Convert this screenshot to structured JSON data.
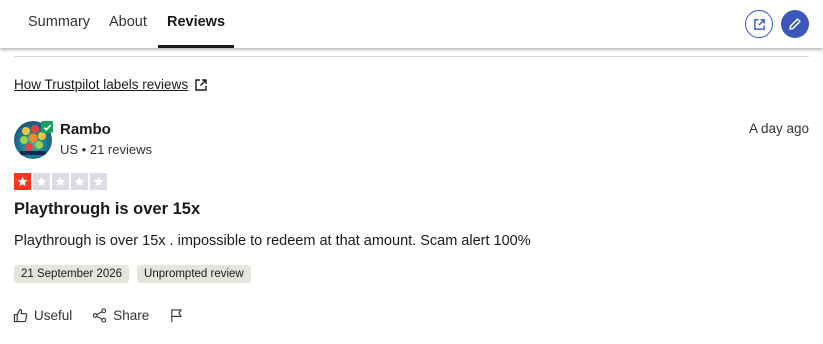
{
  "tabs": [
    {
      "label": "Summary"
    },
    {
      "label": "About"
    },
    {
      "label": "Reviews",
      "active": true
    }
  ],
  "header_buttons": {
    "external_icon": "external-link-icon",
    "edit_icon": "pencil-icon"
  },
  "labels_link": {
    "text": "How Trustpilot labels reviews",
    "icon": "external-link-icon"
  },
  "review": {
    "reviewer": {
      "name": "Rambo",
      "meta": "US • 21 reviews",
      "avatar_icon": "game-avatar",
      "verified_icon": "check-badge-icon"
    },
    "date": "A day ago",
    "rating": 1,
    "rating_max": 5,
    "title": "Playthrough is over 15x",
    "body": "Playthrough is over 15x . impossible to redeem at that amount. Scam alert 100%",
    "tags": [
      "21 September 2026",
      "Unprompted review"
    ],
    "actions": [
      {
        "label": "Useful",
        "icon": "thumbs-up-icon"
      },
      {
        "label": "Share",
        "icon": "share-icon"
      },
      {
        "label": "",
        "icon": "flag-icon"
      }
    ]
  },
  "colors": {
    "accent": "#3c57bc",
    "star_red": "#ff3722",
    "star_empty": "#dcdce6",
    "tag_bg": "#e5e5dd"
  }
}
